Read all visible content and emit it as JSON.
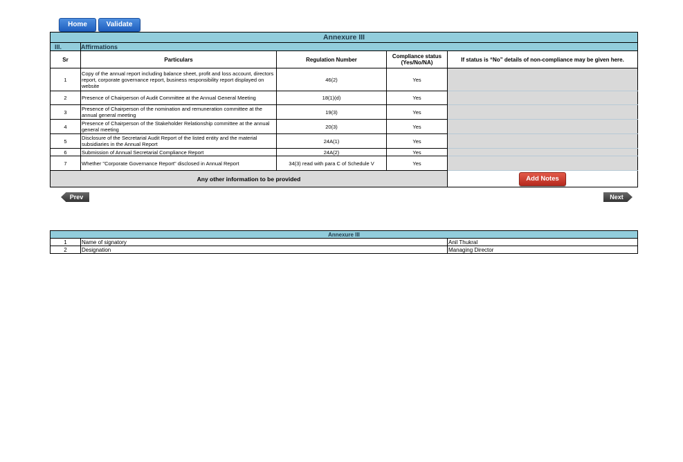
{
  "nav": {
    "home_label": "Home",
    "validate_label": "Validate"
  },
  "annexure": {
    "title": "Annexure III",
    "section_num": "III.",
    "section_title": "Affirmations",
    "headers": {
      "sr": "Sr",
      "particulars": "Particulars",
      "regulation": "Regulation Number",
      "compliance_line1": "Compliance status",
      "compliance_line2": "(Yes/No/NA)",
      "details": "If status is “No” details of non-compliance may be given here."
    },
    "rows": [
      {
        "sr": "1",
        "particulars": "Copy of the annual report including balance sheet, profit and loss account, directors report, corporate governance report, business responsibility report displayed on website",
        "regulation": "46(2)",
        "status": "Yes",
        "details": ""
      },
      {
        "sr": "2",
        "particulars": "Presence of Chairperson of Audit Committee at the Annual General Meeting",
        "regulation": "18(1)(d)",
        "status": "Yes",
        "details": ""
      },
      {
        "sr": "3",
        "particulars": "Presence of Chairperson of the nomination and remuneration committee at the annual general meeting",
        "regulation": "19(3)",
        "status": "Yes",
        "details": ""
      },
      {
        "sr": "4",
        "particulars": "Presence of Chairperson of the Stakeholder Relationship committee at the annual general meeting",
        "regulation": "20(3)",
        "status": "Yes",
        "details": ""
      },
      {
        "sr": "5",
        "particulars": "Disclosure of the Secretarial Audit Report of the listed entity and the material subsidiaries in the Annual Report",
        "regulation": "24A(1)",
        "status": "Yes",
        "details": ""
      },
      {
        "sr": "6",
        "particulars": "Submission of Annual Secretarial Compliance Report",
        "regulation": "24A(2)",
        "status": "Yes",
        "details": ""
      },
      {
        "sr": "7",
        "particulars": "Whether \"Corporate Governance Report\" disclosed in Annual Report",
        "regulation": "34(3) read with para C of Schedule V",
        "status": "Yes",
        "details": ""
      }
    ],
    "other_info_label": "Any other information to be provided",
    "add_notes_label": "Add Notes"
  },
  "pager": {
    "prev_label": "Prev",
    "next_label": "Next"
  },
  "signatory": {
    "title": "Annexure III",
    "rows": [
      {
        "sr": "1",
        "label": "Name of signatory",
        "value": "Anil Thukral"
      },
      {
        "sr": "2",
        "label": "Designation",
        "value": "Managing Director"
      }
    ]
  }
}
